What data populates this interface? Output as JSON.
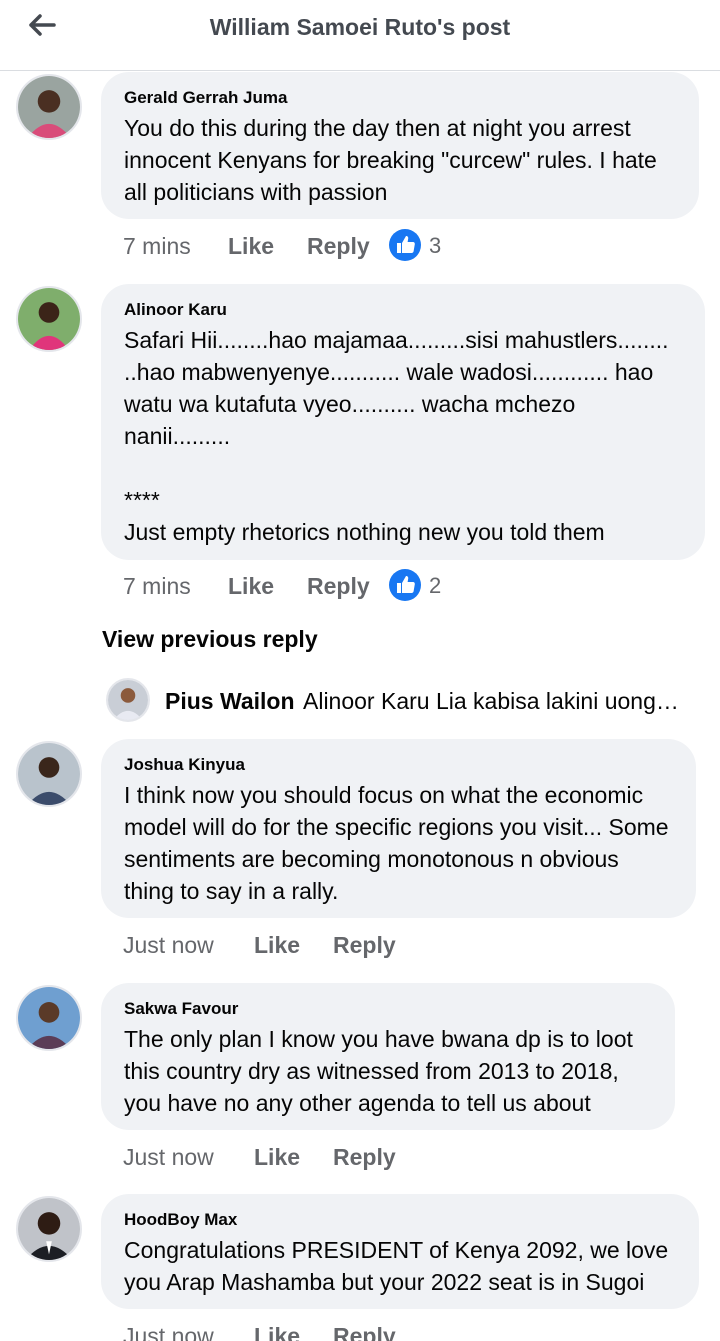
{
  "header": {
    "title": "William Samoei Ruto's post"
  },
  "comments": [
    {
      "author": "Gerald Gerrah Juma",
      "text": "You do this during the day then at  night you arrest innocent Kenyans for breaking \"curcew\" rules. I hate all politicians with passion",
      "time": "7 mins",
      "like_label": "Like",
      "reply_label": "Reply",
      "reactions": "3"
    },
    {
      "author": "Alinoor Karu",
      "text": "Safari Hii........hao majamaa.........sisi mahustlers........ ..hao mabwenyenye........... wale wadosi............ hao watu wa kutafuta vyeo.......... wacha mchezo nanii.........\n\n****\nJust empty rhetorics nothing new you told them",
      "time": "7 mins",
      "like_label": "Like",
      "reply_label": "Reply",
      "reactions": "2"
    },
    {
      "author": "Joshua Kinyua",
      "text": "I think now you should focus on what the economic model will do for the specific regions you visit... Some sentiments are becoming monotonous n obvious thing to say in a rally.",
      "time": "Just now",
      "like_label": "Like",
      "reply_label": "Reply"
    },
    {
      "author": "Sakwa Favour",
      "text": "The only plan I know you have bwana dp is to loot this country  dry as witnessed from 2013 to 2018, you have no any other agenda to tell us about",
      "time": "Just now",
      "like_label": "Like",
      "reply_label": "Reply"
    },
    {
      "author": "HoodBoy Max",
      "text": "Congratulations PRESIDENT of Kenya 2092, we love you Arap Mashamba but your 2022 seat is in Sugoi",
      "time": "Just now",
      "like_label": "Like",
      "reply_label": "Reply"
    }
  ],
  "view_previous_reply": "View previous reply",
  "reply_preview": {
    "author": "Pius Wailon",
    "text": "Alinoor Karu Lia kabisa lakini uongo mtupu"
  },
  "colors": {
    "accent": "#1877f2",
    "bubble": "#f0f2f5",
    "muted_text": "#65676b"
  }
}
